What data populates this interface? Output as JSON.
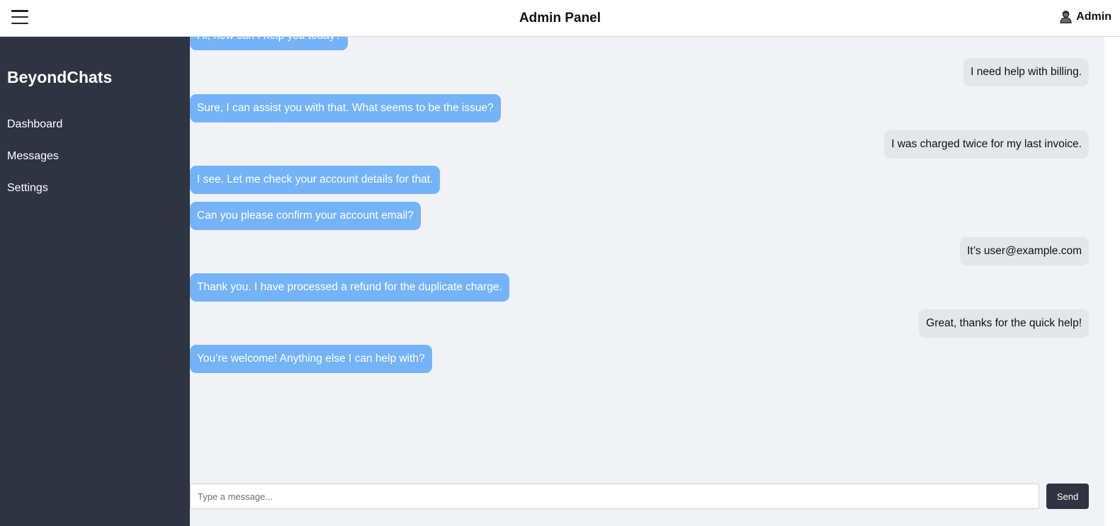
{
  "header": {
    "title": "Admin Panel",
    "menu_icon": "hamburger-menu-icon",
    "user_icon": "user-avatar-icon",
    "user_label": "Admin"
  },
  "sidebar": {
    "brand": "BeyondChats",
    "items": [
      {
        "label": "Dashboard"
      },
      {
        "label": "Messages"
      },
      {
        "label": "Settings"
      }
    ]
  },
  "chat": {
    "messages": [
      {
        "sender": "agent",
        "text": "Hi, how can I help you today?"
      },
      {
        "sender": "user",
        "text": "I need help with billing."
      },
      {
        "sender": "agent",
        "text": "Sure, I can assist you with that. What seems to be the issue?"
      },
      {
        "sender": "user",
        "text": "I was charged twice for my last invoice."
      },
      {
        "sender": "agent",
        "text": "I see. Let me check your account details for that."
      },
      {
        "sender": "agent",
        "text": "Can you please confirm your account email?"
      },
      {
        "sender": "user",
        "text": "It’s user@example.com"
      },
      {
        "sender": "agent",
        "text": "Thank you. I have processed a refund for the duplicate charge."
      },
      {
        "sender": "user",
        "text": "Great, thanks for the quick help!"
      },
      {
        "sender": "agent",
        "text": "You’re welcome! Anything else I can help with?"
      }
    ]
  },
  "composer": {
    "placeholder": "Type a message...",
    "value": "",
    "send_label": "Send"
  },
  "colors": {
    "sidebar_bg": "#2e3441",
    "agent_bubble": "#74b3f7",
    "user_bubble": "#e2e7ea",
    "chat_bg": "#f0f2f5"
  }
}
